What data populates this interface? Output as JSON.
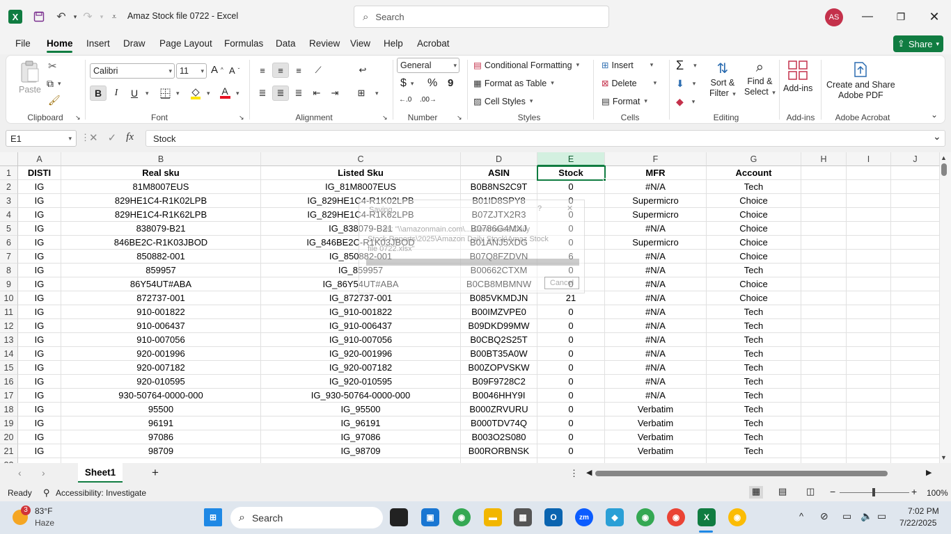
{
  "titlebar": {
    "app_icon": "X",
    "doc_title": "Amaz Stock file 0722  -  Excel",
    "search_placeholder": "Search",
    "avatar_initials": "AS"
  },
  "menu": {
    "items": [
      "File",
      "Home",
      "Insert",
      "Draw",
      "Page Layout",
      "Formulas",
      "Data",
      "Review",
      "View",
      "Help",
      "Acrobat"
    ],
    "share_label": "Share"
  },
  "ribbon": {
    "clipboard": {
      "paste": "Paste",
      "label": "Clipboard"
    },
    "font": {
      "name": "Calibri",
      "size": "11",
      "label": "Font",
      "bold": "B",
      "italic": "I",
      "underline": "U"
    },
    "alignment": {
      "label": "Alignment"
    },
    "number": {
      "format": "General",
      "label": "Number",
      "currency": "$",
      "percent": "%",
      "comma": "9"
    },
    "styles": {
      "conditional": "Conditional Formatting",
      "table": "Format as Table",
      "cell_styles": "Cell Styles",
      "label": "Styles"
    },
    "cells": {
      "insert": "Insert",
      "delete": "Delete",
      "format": "Format",
      "label": "Cells"
    },
    "editing": {
      "sum": "Σ",
      "sort_filter_1": "Sort &",
      "sort_filter_2": "Filter",
      "find_select_1": "Find &",
      "find_select_2": "Select",
      "label": "Editing"
    },
    "addins": {
      "addins": "Add-ins",
      "label": "Add-ins"
    },
    "acrobat": {
      "create_1": "Create and Share",
      "create_2": "Adobe PDF",
      "label": "Adobe Acrobat"
    }
  },
  "formula_bar": {
    "name_box": "E1",
    "formula": "Stock"
  },
  "grid": {
    "columns": [
      "A",
      "B",
      "C",
      "D",
      "E",
      "F",
      "G",
      "H",
      "I",
      "J"
    ],
    "headers": [
      "DISTI",
      "Real sku",
      "Listed Sku",
      "ASIN",
      "Stock",
      "MFR",
      "Account"
    ],
    "rows": [
      [
        "IG",
        "81M8007EUS",
        "IG_81M8007EUS",
        "B0B8NS2C9T",
        "0",
        "#N/A",
        "Tech"
      ],
      [
        "IG",
        "829HE1C4-R1K02LPB",
        "IG_829HE1C4-R1K02LPB",
        "B01ID8SPY8",
        "0",
        "Supermicro",
        "Choice"
      ],
      [
        "IG",
        "829HE1C4-R1K62LPB",
        "IG_829HE1C4-R1K62LPB",
        "B07ZJTX2R3",
        "0",
        "Supermicro",
        "Choice"
      ],
      [
        "IG",
        "838079-B21",
        "IG_838079-B21",
        "B0786G4MXJ",
        "0",
        "#N/A",
        "Choice"
      ],
      [
        "IG",
        "846BE2C-R1K03JBOD",
        "IG_846BE2C-R1K03JBOD",
        "B01ANJ5XDG",
        "0",
        "Supermicro",
        "Choice"
      ],
      [
        "IG",
        "850882-001",
        "IG_850882-001",
        "B07Q8FZDVN",
        "6",
        "#N/A",
        "Choice"
      ],
      [
        "IG",
        "859957",
        "IG_859957",
        "B00662CTXM",
        "0",
        "#N/A",
        "Tech"
      ],
      [
        "IG",
        "86Y54UT#ABA",
        "IG_86Y54UT#ABA",
        "B0CB8MBMNW",
        "0",
        "#N/A",
        "Choice"
      ],
      [
        "IG",
        "872737-001",
        "IG_872737-001",
        "B085VKMDJN",
        "21",
        "#N/A",
        "Choice"
      ],
      [
        "IG",
        "910-001822",
        "IG_910-001822",
        "B00IMZVPE0",
        "0",
        "#N/A",
        "Tech"
      ],
      [
        "IG",
        "910-006437",
        "IG_910-006437",
        "B09DKD99MW",
        "0",
        "#N/A",
        "Tech"
      ],
      [
        "IG",
        "910-007056",
        "IG_910-007056",
        "B0CBQ2S25T",
        "0",
        "#N/A",
        "Tech"
      ],
      [
        "IG",
        "920-001996",
        "IG_920-001996",
        "B00BT35A0W",
        "0",
        "#N/A",
        "Tech"
      ],
      [
        "IG",
        "920-007182",
        "IG_920-007182",
        "B00ZOPVSKW",
        "0",
        "#N/A",
        "Tech"
      ],
      [
        "IG",
        "920-010595",
        "IG_920-010595",
        "B09F9728C2",
        "0",
        "#N/A",
        "Tech"
      ],
      [
        "IG",
        "930-50764-0000-000",
        "IG_930-50764-0000-000",
        "B0046HHY9I",
        "0",
        "#N/A",
        "Tech"
      ],
      [
        "IG",
        "95500",
        "IG_95500",
        "B000ZRVURU",
        "0",
        "Verbatim",
        "Tech"
      ],
      [
        "IG",
        "96191",
        "IG_96191",
        "B000TDV74Q",
        "0",
        "Verbatim",
        "Tech"
      ],
      [
        "IG",
        "97086",
        "IG_97086",
        "B003O2S080",
        "0",
        "Verbatim",
        "Tech"
      ],
      [
        "IG",
        "98709",
        "IG_98709",
        "B00RORBNSK",
        "0",
        "Verbatim",
        "Tech"
      ]
    ]
  },
  "ghost_dialog": {
    "line1": "Saving",
    "line2": "as: \"\\\\amazonmain.com\\...\\Commerce\\Daily",
    "line3": "Stock Reports\\2025\\Amazon Daily Stock\\Amaz Stock",
    "line4": "file 0722.xlsx\"",
    "cancel": "Cancel"
  },
  "sheets": {
    "active": "Sheet1",
    "add": "+"
  },
  "status": {
    "ready": "Ready",
    "accessibility": "Accessibility: Investigate",
    "zoom": "100%"
  },
  "taskbar": {
    "weather_temp": "83°F",
    "weather_desc": "Haze",
    "weather_badge": "3",
    "search": "Search",
    "time": "7:02 PM",
    "date": "7/22/2025"
  },
  "colors": {
    "accent": "#107c41",
    "avatar": "#c4314b"
  }
}
